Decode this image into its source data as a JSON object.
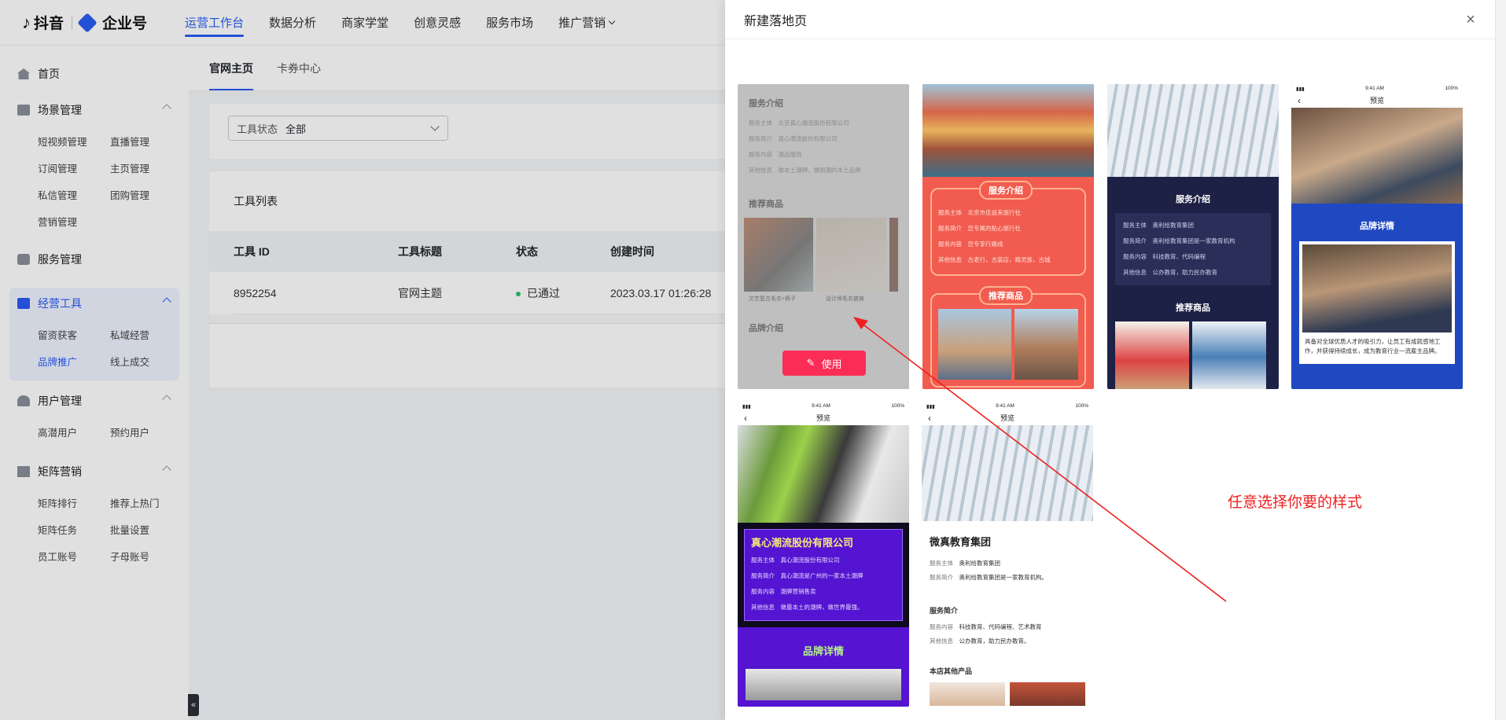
{
  "topbar": {
    "brand_douyin": "抖音",
    "brand_enterprise": "企业号",
    "nav": [
      {
        "label": "运营工作台",
        "active": true
      },
      {
        "label": "数据分析"
      },
      {
        "label": "商家学堂"
      },
      {
        "label": "创意灵感"
      },
      {
        "label": "服务市场"
      },
      {
        "label": "推广营销"
      }
    ]
  },
  "sidebar": {
    "home": "首页",
    "groups": [
      {
        "title": "场景管理",
        "items": [
          "短视频管理",
          "直播管理",
          "订阅管理",
          "主页管理",
          "私信管理",
          "团购管理",
          "营销管理"
        ]
      },
      {
        "title": "服务管理",
        "items": []
      },
      {
        "title": "经营工具",
        "items": [
          "留资获客",
          "私域经营",
          "品牌推广",
          "线上成交"
        ],
        "active": true,
        "active_item": "品牌推广"
      },
      {
        "title": "用户管理",
        "items": [
          "高潜用户",
          "预约用户"
        ]
      },
      {
        "title": "矩阵营销",
        "items": [
          "矩阵排行",
          "推荐上热门",
          "矩阵任务",
          "批量设置",
          "员工账号",
          "子母账号"
        ]
      }
    ]
  },
  "main": {
    "tabs": [
      "官网主页",
      "卡券中心"
    ],
    "filter": {
      "label": "工具状态",
      "value": "全部"
    },
    "list_title": "工具列表",
    "columns": [
      "工具 ID",
      "工具标题",
      "状态",
      "创建时间"
    ],
    "rows": [
      {
        "id": "8952254",
        "title": "官网主题",
        "status": "已通过",
        "created": "2023.03.17 01:26:28"
      }
    ]
  },
  "drawer": {
    "title": "新建落地页",
    "use_button": "使用",
    "annotation": "任意选择你要的样式",
    "templates": {
      "t1": {
        "section1": "服务介绍",
        "rows": [
          "服务主体",
          "服务简介",
          "服务内容",
          "其他信息"
        ],
        "values": [
          "北京真心潮流股份有限公司",
          "真心潮流股份有限公司",
          "潮品服饰",
          "做本土潮牌，做国潮的本土品牌"
        ],
        "section2": "推荐商品",
        "caption1": "文艺复古毛衣+裤子",
        "caption2": "设计师毛衣披肩",
        "section3": "品牌介绍"
      },
      "t2": {
        "section1": "服务介绍",
        "rows": [
          "服务主体",
          "服务简介",
          "服务内容",
          "其他信息"
        ],
        "values": [
          "北京市佳益来旅行社",
          "您专属的贴心旅行社",
          "您专享行路线",
          "古老行，古装店，精灵族，古城"
        ],
        "section2": "推荐商品"
      },
      "t3": {
        "section1": "服务介绍",
        "rows": [
          "服务主体",
          "服务简介",
          "服务内容",
          "其他信息"
        ],
        "values": [
          "奥利给教育集团",
          "奥利给教育集团是一家教育机构",
          "科技教育、代码编程",
          "公办教育，助力民办教育"
        ],
        "section2": "推荐商品"
      },
      "t4": {
        "status_time": "9:41 AM",
        "battery": "100%",
        "header": "预览",
        "section": "品牌详情",
        "desc": "具备对全球优质人才的吸引力，让员工有成就感地工作，并获得持续成长，成为教育行业一流雇主品牌。"
      },
      "t5": {
        "status_time": "9:41 AM",
        "battery": "100%",
        "header": "预览",
        "company": "真心潮流股份有限公司",
        "rows": [
          "服务主体",
          "服务简介",
          "服务内容",
          "其他信息"
        ],
        "values": [
          "真心潮流股份有限公司",
          "真心潮流是广州的一家本土潮牌",
          "潮牌营销售卖",
          "做最本土的潮牌，做世界最强。"
        ],
        "section": "品牌详情"
      },
      "t6": {
        "status_time": "9:41 AM",
        "battery": "100%",
        "header": "预览",
        "company": "微真教育集团",
        "rows1": [
          "服务主体",
          "服务简介"
        ],
        "values1": [
          "奥利给教育集团",
          "奥利给教育集团是一家教育机构。"
        ],
        "section": "服务简介",
        "rows2": [
          "服务内容",
          "其他信息"
        ],
        "values2": [
          "科技教育、代码编程、艺术教育",
          "公办教育，助力民办教育。"
        ],
        "section2": "本店其他产品"
      }
    }
  },
  "colors": {
    "accent": "#2a5cf5",
    "use_button": "#fb2c56",
    "annotation": "#f02020",
    "edu_navy": "#1d2145",
    "coral": "#f25b4f",
    "purple": "#5514d1",
    "royal_blue": "#1f48c1"
  }
}
